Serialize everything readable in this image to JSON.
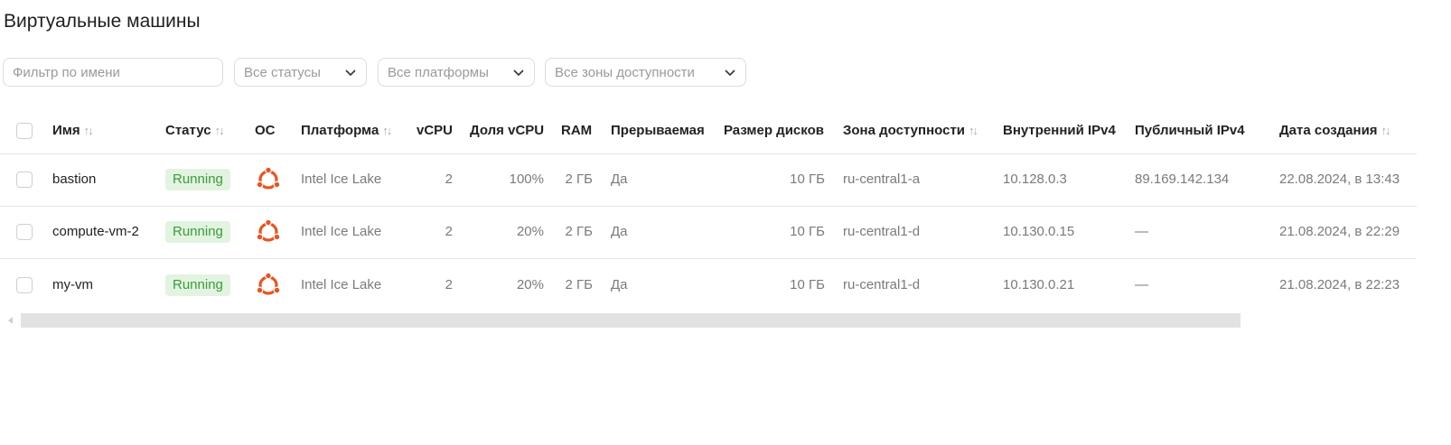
{
  "page": {
    "title": "Виртуальные машины"
  },
  "filters": {
    "name_placeholder": "Фильтр по имени",
    "status_value": "Все статусы",
    "platform_value": "Все платформы",
    "zone_value": "Все зоны доступности"
  },
  "columns": {
    "name": "Имя",
    "status": "Статус",
    "os": "ОС",
    "platform": "Платформа",
    "vcpu": "vCPU",
    "vcpu_share": "Доля vCPU",
    "ram": "RAM",
    "preemptible": "Прерываемая",
    "disk_size": "Размер дисков",
    "zone": "Зона доступности",
    "internal_ip": "Внутренний IPv4",
    "public_ip": "Публичный IPv4",
    "created": "Дата создания"
  },
  "rows": [
    {
      "name": "bastion",
      "status": "Running",
      "os_icon": "ubuntu-icon",
      "platform": "Intel Ice Lake",
      "vcpu": "2",
      "vcpu_share": "100%",
      "ram": "2 ГБ",
      "preemptible": "Да",
      "disk_size": "10 ГБ",
      "zone": "ru-central1-a",
      "internal_ip": "10.128.0.3",
      "public_ip": "89.169.142.134",
      "created": "22.08.2024, в 13:43"
    },
    {
      "name": "compute-vm-2",
      "status": "Running",
      "os_icon": "ubuntu-icon",
      "platform": "Intel Ice Lake",
      "vcpu": "2",
      "vcpu_share": "20%",
      "ram": "2 ГБ",
      "preemptible": "Да",
      "disk_size": "10 ГБ",
      "zone": "ru-central1-d",
      "internal_ip": "10.130.0.15",
      "public_ip": "—",
      "created": "21.08.2024, в 22:29"
    },
    {
      "name": "my-vm",
      "status": "Running",
      "os_icon": "ubuntu-icon",
      "platform": "Intel Ice Lake",
      "vcpu": "2",
      "vcpu_share": "20%",
      "ram": "2 ГБ",
      "preemptible": "Да",
      "disk_size": "10 ГБ",
      "zone": "ru-central1-d",
      "internal_ip": "10.130.0.21",
      "public_ip": "—",
      "created": "21.08.2024, в 22:23"
    }
  ],
  "colors": {
    "status_bg": "#e2f4e0",
    "status_text": "#3c9a3a",
    "ubuntu": "#e95420"
  }
}
